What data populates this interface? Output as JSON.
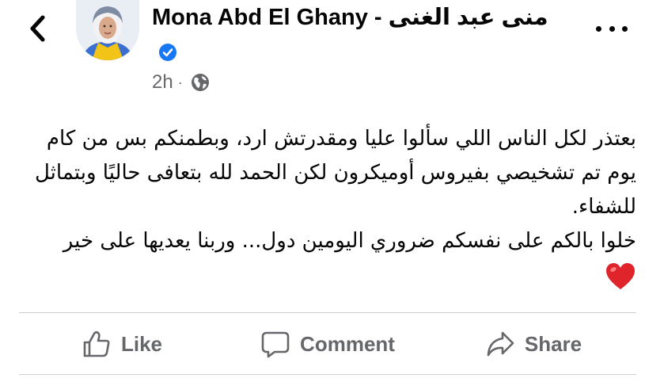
{
  "header": {
    "author_name": "Mona Abd El Ghany - منى عبد الغنى",
    "timestamp": "2h",
    "separator": "·",
    "verified": true,
    "privacy_icon": "globe-icon",
    "back_icon": "chevron-left-icon",
    "more_icon": "more-horizontal-icon"
  },
  "post": {
    "lines": [
      "بعتذر لكل الناس اللي سألوا عليا ومقدرتش ارد، وبطمنكم بس من كام يوم تم تشخيصي بفيروس أوميكرون لكن الحمد لله بتعافى حاليًا وبتماثل للشفاء.",
      "خلوا بالكم على نفسكم ضروري اليومين دول... وربنا يعديها على خير"
    ],
    "emoji": "red-heart-emoji"
  },
  "actions": {
    "like_label": "Like",
    "comment_label": "Comment",
    "share_label": "Share"
  },
  "colors": {
    "text": "#050505",
    "secondary": "#65676b",
    "verified_blue": "#1877f2",
    "divider": "#ced0d4",
    "heart_red": "#e0242c"
  }
}
